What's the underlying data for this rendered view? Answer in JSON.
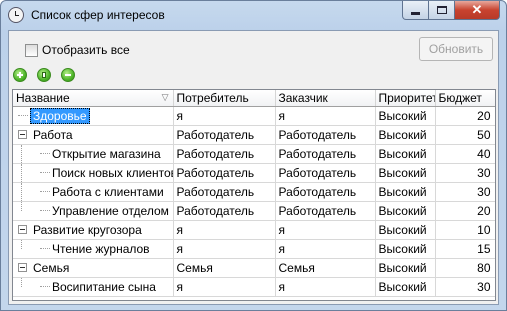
{
  "window": {
    "title": "Список сфер интересов"
  },
  "controls": {
    "show_all_label": "Отобразить все",
    "refresh_label": "Обновить"
  },
  "toolbar": {
    "add_icon": "add-icon",
    "edit_icon": "edit-icon",
    "remove_icon": "remove-icon",
    "accent": "#4fb52a"
  },
  "grid": {
    "columns": [
      "Название",
      "Потребитель",
      "Заказчик",
      "Приоритет",
      "Бюджет"
    ],
    "rows": [
      {
        "name": "Здоровье",
        "consumer": "я",
        "customer": "я",
        "priority": "Высокий",
        "budget": "20"
      },
      {
        "name": "Работа",
        "consumer": "Работодатель",
        "customer": "Работодатель",
        "priority": "Высокий",
        "budget": "50"
      },
      {
        "name": "Открытие магазина",
        "consumer": "Работодатель",
        "customer": "Работодатель",
        "priority": "Высокий",
        "budget": "40"
      },
      {
        "name": "Поиск новых клиентов",
        "consumer": "Работодатель",
        "customer": "Работодатель",
        "priority": "Высокий",
        "budget": "30"
      },
      {
        "name": "Работа с клиентами",
        "consumer": "Работодатель",
        "customer": "Работодатель",
        "priority": "Высокий",
        "budget": "30"
      },
      {
        "name": "Управление отделом",
        "consumer": "Работодатель",
        "customer": "Работодатель",
        "priority": "Высокий",
        "budget": "20"
      },
      {
        "name": "Развитие кругозора",
        "consumer": "я",
        "customer": "я",
        "priority": "Высокий",
        "budget": "10"
      },
      {
        "name": "Чтение журналов",
        "consumer": "я",
        "customer": "я",
        "priority": "Высокий",
        "budget": "15"
      },
      {
        "name": "Семья",
        "consumer": "Семья",
        "customer": "Семья",
        "priority": "Высокий",
        "budget": "80"
      },
      {
        "name": "Восипитание сына",
        "consumer": "я",
        "customer": "я",
        "priority": "Высокий",
        "budget": "30"
      }
    ]
  },
  "colors": {
    "selection": "#3399ff",
    "close_button": "#c8432f"
  }
}
